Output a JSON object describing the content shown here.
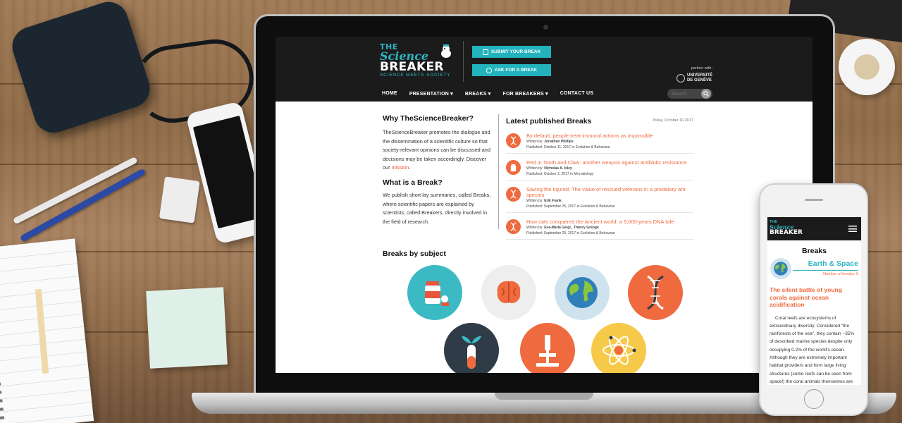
{
  "site": {
    "logo_line1": "THE",
    "logo_line2": "Science",
    "logo_line3": "BREAKER",
    "logo_tagline": "SCIENCE MEETS SOCIETY",
    "cta_submit": "SUBMIT YOUR BREAK",
    "cta_ask": "ASK FOR A BREAK",
    "partner_label": "partner with:",
    "partner_name_1": "UNIVERSITÉ",
    "partner_name_2": "DE GENÈVE",
    "nav": [
      "HOME",
      "PRESENTATION ▾",
      "BREAKS ▾",
      "FOR BREAKERS ▾",
      "CONTACT US"
    ],
    "search_placeholder": "Search..."
  },
  "left": {
    "why_title": "Why TheScienceBreaker?",
    "why_text": "TheScienceBreaker promotes the dialogue and the dissemination of a scientific culture so that society-relevant opinions can be discussed and decisions may be taken accordingly. Discover our",
    "why_link": "mission",
    "what_title": "What is a Break?",
    "what_text": "We publish short lay summaries, called Breaks, where scientific papers are explained by scientists, called Breakers, directly involved in the field of research."
  },
  "latest": {
    "title": "Latest published Breaks",
    "date": "Today, October 16 2017",
    "items": [
      {
        "title": "By default, people treat immoral actions as impossible",
        "written_label": "Written by:",
        "author": "Jonathan Phillips",
        "published": "Published: October 11, 2017 in Evolution & Behaviour",
        "icon": "dna-icon"
      },
      {
        "title": "Red in Tooth and Claw: another weapon against antibiotic resistance",
        "written_label": "Written by:",
        "author": "Nicholas A. Isley",
        "published": "Published: October 3, 2017 in Microbiology",
        "icon": "medicine-icon"
      },
      {
        "title": "Saving the injured: The value of rescued veterans in a predatory ant species",
        "written_label": "Written by:",
        "author": "Erik Frank",
        "published": "Published: September 25, 2017 in Evolution & Behaviour",
        "icon": "dna-icon"
      },
      {
        "title": "How cats conquered the Ancient world: a 9,000-years DNA tale",
        "written_label": "Written by:",
        "author": "Eva-Maria Geigl , Thierry Grange",
        "published": "Published: September 20, 2017 in Evolution & Behaviour",
        "icon": "dna-icon"
      }
    ]
  },
  "subjects": {
    "title": "Breaks by subject",
    "items": [
      {
        "icon": "medicine-bottle-icon",
        "color": "#3cbac4"
      },
      {
        "icon": "brain-icon",
        "color": "#eeeeee"
      },
      {
        "icon": "earth-icon",
        "color": "#cfe3ef"
      },
      {
        "icon": "dna-icon",
        "color": "#ef6a3f"
      },
      {
        "icon": "plant-test-tube-icon",
        "color": "#2f3b46"
      },
      {
        "icon": "microscope-icon",
        "color": "#ef6a3f"
      },
      {
        "icon": "atom-icon",
        "color": "#f7c948"
      }
    ]
  },
  "mobile": {
    "logo_line1": "THE",
    "logo_line2": "Science",
    "logo_line3": "BREAKER",
    "page_title": "Breaks",
    "category": "Earth & Space",
    "count": "Number of breaks: 9",
    "article_title": "The silent battle of young corals against ocean acidification",
    "article_body": "Coral reefs are ecosystems of extraordinary diversity. Considered \"the rainforests of the sea\", they contain ~35% of described marine species despite only occupying 0.2% of the world's ocean. Although they are extremely important habitat providers and form large living structures (some reefs can be seen from space!) the coral animals themselves are"
  },
  "colors": {
    "accent": "#2cb6c3",
    "orange": "#ef6a3f",
    "header": "#1b1b1b"
  }
}
